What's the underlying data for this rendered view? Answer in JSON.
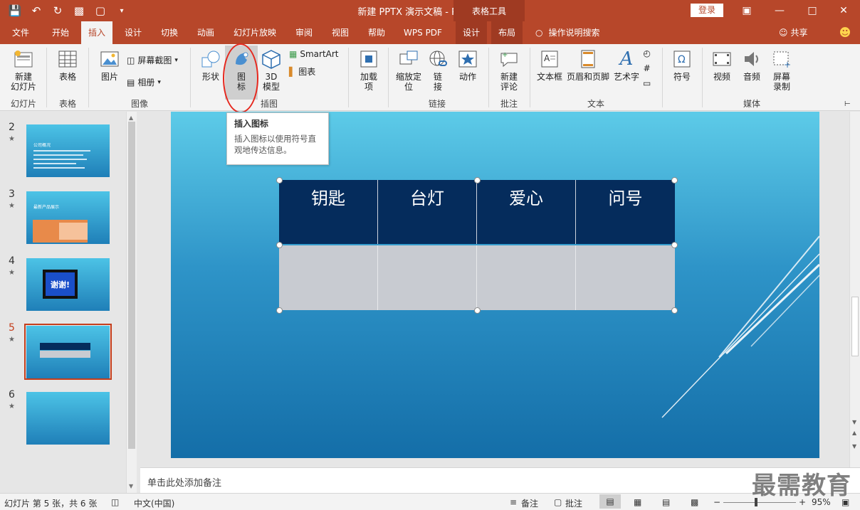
{
  "window": {
    "title": "新建 PPTX 演示文稿  -  PowerPoint",
    "context_tool": "表格工具",
    "login_label": "登录"
  },
  "tabs": [
    {
      "label": "文件",
      "active": false
    },
    {
      "label": "开始",
      "active": false
    },
    {
      "label": "插入",
      "active": true
    },
    {
      "label": "设计",
      "active": false
    },
    {
      "label": "切换",
      "active": false
    },
    {
      "label": "动画",
      "active": false
    },
    {
      "label": "幻灯片放映",
      "active": false
    },
    {
      "label": "审阅",
      "active": false
    },
    {
      "label": "视图",
      "active": false
    },
    {
      "label": "帮助",
      "active": false
    },
    {
      "label": "WPS PDF",
      "active": false
    },
    {
      "label": "设计",
      "active": false
    },
    {
      "label": "布局",
      "active": false
    }
  ],
  "tell_me": "操作说明搜索",
  "share_label": "共享",
  "ribbon": {
    "new_slide": "新建\n幻灯片",
    "table": "表格",
    "picture": "图片",
    "screenshot": "屏幕截图",
    "album": "相册",
    "shapes": "形状",
    "icons": "图\n标",
    "model3d": "3D\n模型",
    "smartart": "SmartArt",
    "chart": "图表",
    "addins": "加载\n项",
    "zoom": "缩放定\n位",
    "link": "链\n接",
    "action": "动作",
    "new_comment": "新建\n评论",
    "textbox": "文本框",
    "header_footer": "页眉和页脚",
    "wordart": "艺术字",
    "symbol": "符号",
    "video": "视频",
    "audio": "音频",
    "screen_record": "屏幕\n录制"
  },
  "ribbon_groups": {
    "slides": "幻灯片",
    "tables": "表格",
    "images": "图像",
    "illustrations": "插图",
    "links": "链接",
    "comments": "批注",
    "text": "文本",
    "media": "媒体"
  },
  "tooltip": {
    "title": "插入图标",
    "desc": "插入图标以使用符号直观地传达信息。"
  },
  "thumbnails": [
    {
      "num": "2",
      "star": "★",
      "text": "公司概况"
    },
    {
      "num": "3",
      "star": "★",
      "text": "最新产品展示"
    },
    {
      "num": "4",
      "star": "★",
      "text": "谢谢!"
    },
    {
      "num": "5",
      "star": "★",
      "text": ""
    },
    {
      "num": "6",
      "star": "★",
      "text": ""
    }
  ],
  "table": {
    "headers": [
      "钥匙",
      "台灯",
      "爱心",
      "问号"
    ]
  },
  "notes_placeholder": "单击此处添加备注",
  "status": {
    "slide_info": "幻灯片 第 5 张，共 6 张",
    "language": "中文(中国)",
    "notes_btn": "备注",
    "comments_btn": "批注",
    "zoom": "95%"
  },
  "watermark": "最需教育",
  "colors": {
    "accent": "#b7472a",
    "table_header": "#052c5c",
    "table_body": "#c8cbd1"
  }
}
